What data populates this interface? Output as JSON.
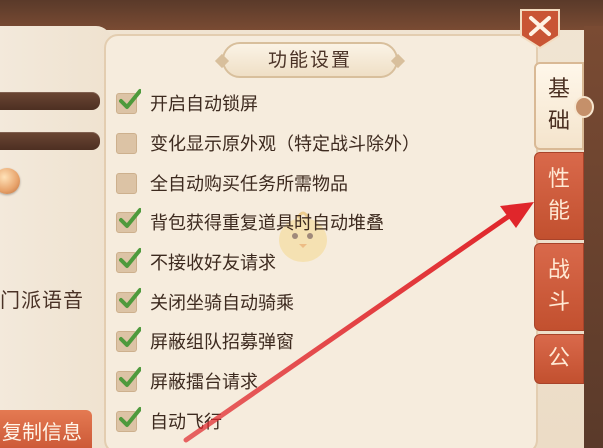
{
  "left_panel": {
    "voice_label": "门派语音",
    "copy_button_label": "复制信息"
  },
  "settings": {
    "title": "功能设置",
    "options": [
      {
        "label": "开启自动锁屏",
        "checked": true
      },
      {
        "label": "变化显示原外观（特定战斗除外）",
        "checked": false
      },
      {
        "label": "全自动购买任务所需物品",
        "checked": false
      },
      {
        "label": "背包获得重复道具时自动堆叠",
        "checked": true
      },
      {
        "label": "不接收好友请求",
        "checked": true
      },
      {
        "label": "关闭坐骑自动骑乘",
        "checked": true
      },
      {
        "label": "屏蔽组队招募弹窗",
        "checked": true
      },
      {
        "label": "屏蔽擂台请求",
        "checked": true
      },
      {
        "label": "自动飞行",
        "checked": true
      }
    ]
  },
  "tabs": [
    {
      "chars": [
        "基",
        "础"
      ],
      "active": true
    },
    {
      "chars": [
        "性",
        "能"
      ],
      "active": false
    },
    {
      "chars": [
        "战",
        "斗"
      ],
      "active": false
    },
    {
      "chars": [
        "公"
      ],
      "active": false
    }
  ],
  "icons": {
    "close": "close-x-icon",
    "check": "green-check-icon",
    "mascot": "chick-mascot-watermark",
    "annotation": "red-arrow-annotation"
  },
  "colors": {
    "check_green": "#4e9a3c",
    "tab_red": "#c95534",
    "arrow_red": "#e0262b",
    "text_brown": "#3d2a1f"
  }
}
